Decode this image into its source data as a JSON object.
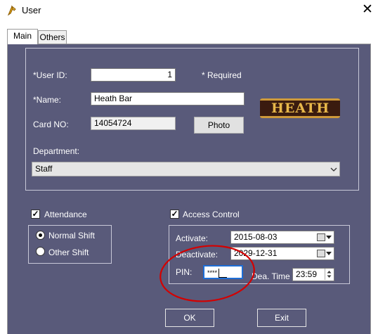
{
  "window": {
    "title": "User",
    "close_glyph": "✕"
  },
  "tabs": [
    {
      "label": "Main"
    },
    {
      "label": "Others"
    }
  ],
  "form": {
    "user_id_label": "*User ID:",
    "user_id_value": "1",
    "required_note": "* Required",
    "name_label": "*Name:",
    "name_value": "Heath Bar",
    "card_label": "Card NO:",
    "card_value": "14054724",
    "photo_button": "Photo",
    "photo_logo_text": "HEATH",
    "department_label": "Department:",
    "department_value": "Staff"
  },
  "attendance": {
    "label": "Attendance",
    "checked": true,
    "options": [
      {
        "label": "Normal Shift",
        "selected": true
      },
      {
        "label": "Other Shift",
        "selected": false
      }
    ]
  },
  "access": {
    "label": "Access Control",
    "checked": true,
    "activate_label": "Activate:",
    "activate_value": "2015-08-03",
    "deactivate_label": "Deactivate:",
    "deactivate_value": "2029-12-31",
    "pin_label": "PIN:",
    "pin_value": "****",
    "dea_time_label": "Dea. Time",
    "dea_time_value": "23:59"
  },
  "buttons": {
    "ok": "OK",
    "exit": "Exit"
  },
  "colors": {
    "panel_bg": "#595a7a",
    "annotation_circle": "#d40000",
    "logo_brown": "#3a1b0f",
    "logo_gold": "#e8b84a"
  }
}
